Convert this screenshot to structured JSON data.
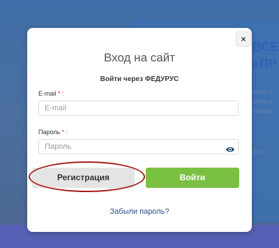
{
  "background": {
    "heading": "ВСЕ\n«ПР",
    "lines": [
      "кцию с",
      "ючая с",
      "к класс",
      "24 г."
    ]
  },
  "modal": {
    "close_label": "×",
    "title": "Вход на сайт",
    "fedurus_link": "Войти через ФЕДУРУС",
    "email": {
      "label": "E-mail",
      "required_mark": "* :",
      "placeholder": "E-mail",
      "value": ""
    },
    "password": {
      "label": "Пароль",
      "required_mark": "* :",
      "placeholder": "Пароль",
      "value": "",
      "toggle_icon": "eye-icon"
    },
    "register_label": "Регистрация",
    "login_label": "Войти",
    "forgot_label": "Забыли пароль?"
  },
  "colors": {
    "login_button": "#7ac143",
    "register_button": "#e4e4e4",
    "highlight": "#a51c1c",
    "page_background": "#4a6fa0"
  }
}
